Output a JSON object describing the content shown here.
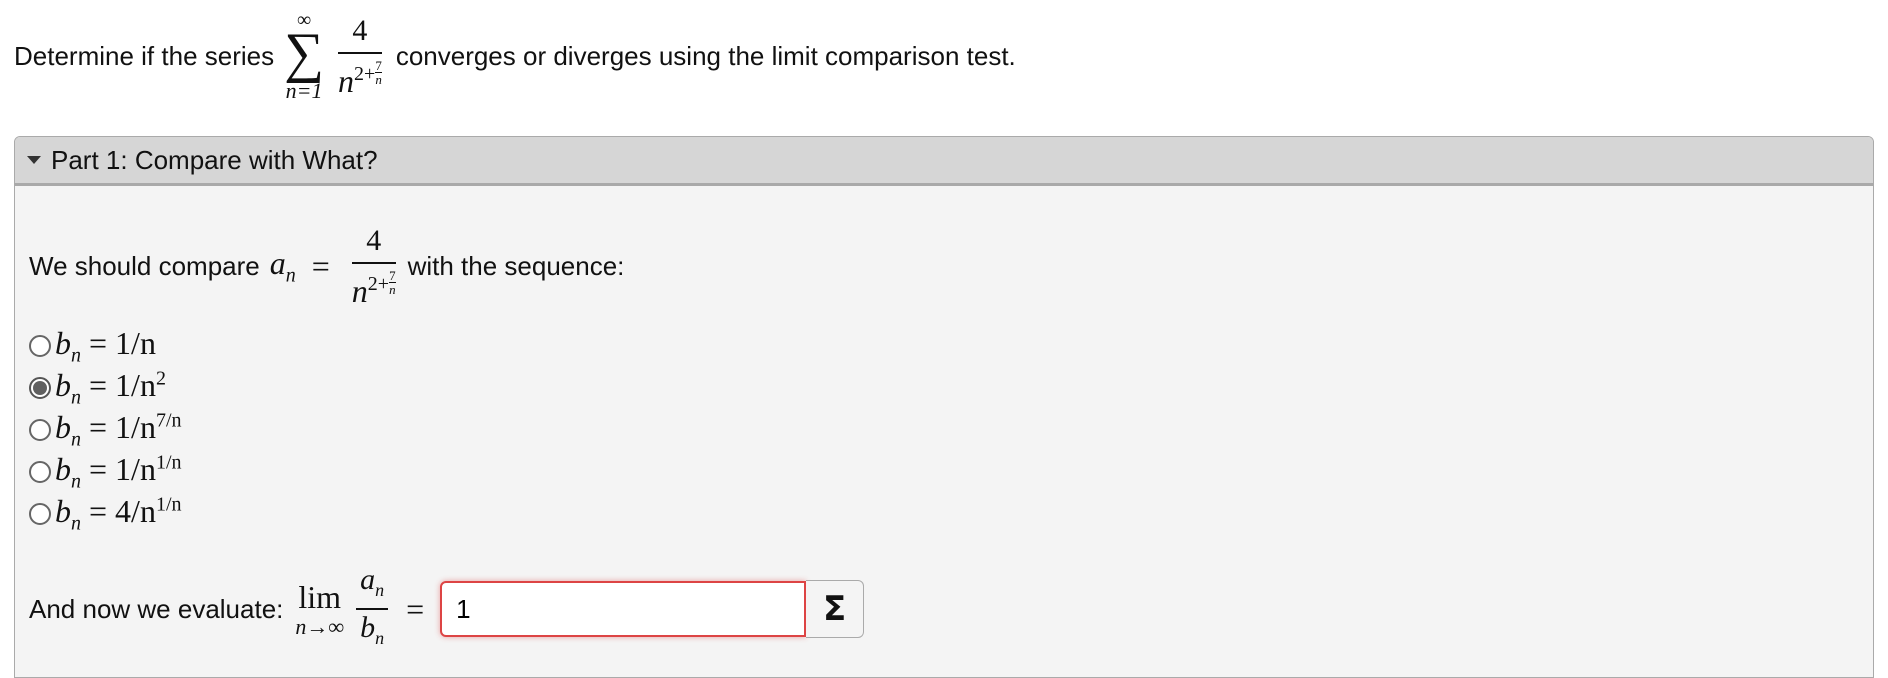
{
  "question": {
    "text_before": "Determine if the series",
    "sum_upper": "∞",
    "sum_symbol": "∑",
    "sum_lower": "n=1",
    "numerator": "4",
    "denominator_base": "n",
    "exponent_prefix": "2+",
    "exponent_frac_num": "7",
    "exponent_frac_den": "n",
    "text_after": "converges or diverges using the limit comparison test."
  },
  "part1": {
    "title": "Part 1: Compare with What?",
    "compare_text": "We should compare",
    "an_label": "a",
    "an_sub": "n",
    "equals": "=",
    "compare_suffix": "with the sequence:",
    "options": [
      {
        "lhs": "b",
        "lhs_sub": "n",
        "eq": "=",
        "rhs": "1/n",
        "sup": ""
      },
      {
        "lhs": "b",
        "lhs_sub": "n",
        "eq": "=",
        "rhs": "1/n",
        "sup": "2"
      },
      {
        "lhs": "b",
        "lhs_sub": "n",
        "eq": "=",
        "rhs": "1/n",
        "sup": "7/n"
      },
      {
        "lhs": "b",
        "lhs_sub": "n",
        "eq": "=",
        "rhs": "1/n",
        "sup": "1/n"
      },
      {
        "lhs": "b",
        "lhs_sub": "n",
        "eq": "=",
        "rhs": "4/n",
        "sup": "1/n"
      }
    ],
    "selected_index": 1,
    "evaluate_text": "And now we evaluate:",
    "lim": "lim",
    "lim_sub": "n→∞",
    "frac_num": "a",
    "frac_num_sub": "n",
    "frac_den": "b",
    "frac_den_sub": "n",
    "answer_value": "1",
    "sigma_button": "Σ"
  },
  "colors": {
    "panel_header": "#d6d6d6",
    "panel_body": "#f4f4f4",
    "input_error_border": "#dd4444"
  }
}
